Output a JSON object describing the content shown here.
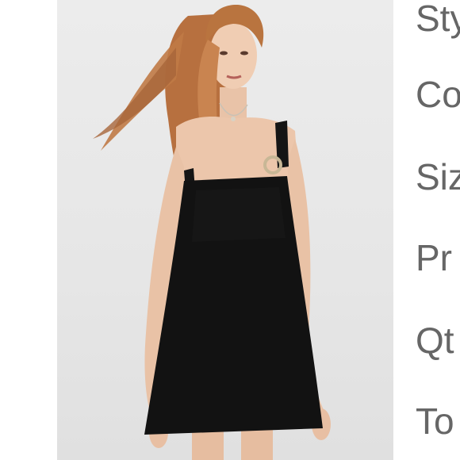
{
  "product_image": {
    "subject": "model wearing black sleeveless mini dress",
    "background_color": "#e8e8e8",
    "dress_color": "#111111"
  },
  "detail_labels": [
    {
      "text": "Sty"
    },
    {
      "text": "Co"
    },
    {
      "text": "Siz"
    },
    {
      "text": "Pr"
    },
    {
      "text": "Qt"
    },
    {
      "text": "To"
    }
  ]
}
